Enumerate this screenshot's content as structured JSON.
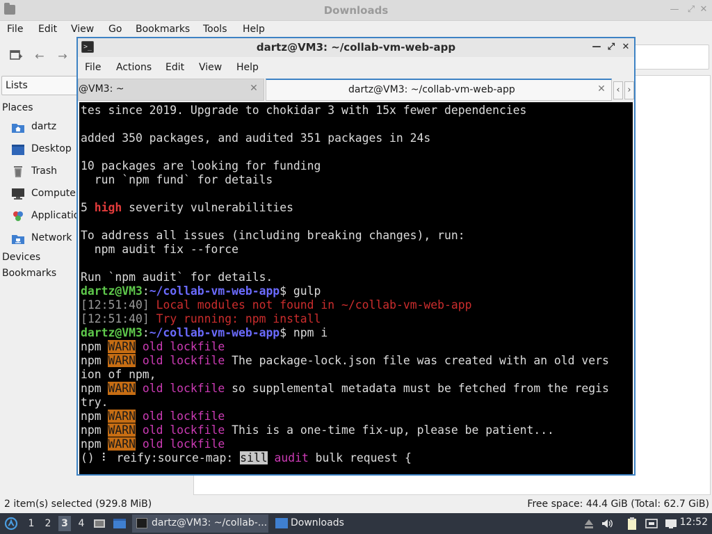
{
  "file_manager": {
    "title": "Downloads",
    "menu": [
      "File",
      "Edit",
      "View",
      "Go",
      "Bookmarks",
      "Tools",
      "Help"
    ],
    "side_combo": "Lists",
    "places_heading": "Places",
    "places": [
      {
        "label": "dartz",
        "icon": "home-folder-icon"
      },
      {
        "label": "Desktop",
        "icon": "desktop-icon"
      },
      {
        "label": "Trash",
        "icon": "trash-icon"
      },
      {
        "label": "Computer",
        "icon": "computer-icon"
      },
      {
        "label": "Applications",
        "icon": "applications-icon"
      },
      {
        "label": "Network",
        "icon": "network-icon"
      }
    ],
    "devices_heading": "Devices",
    "bookmarks_heading": "Bookmarks",
    "status_left": "2 item(s) selected (929.8 MiB)",
    "status_right": "Free space: 44.4 GiB (Total: 62.7 GiB)"
  },
  "terminal": {
    "title": "dartz@VM3: ~/collab-vm-web-app",
    "menu": [
      "File",
      "Actions",
      "Edit",
      "View",
      "Help"
    ],
    "tabs": [
      {
        "label": "@VM3: ~",
        "active": false
      },
      {
        "label": "dartz@VM3: ~/collab-vm-web-app",
        "active": true
      }
    ],
    "lines": [
      [
        {
          "t": "tes since 2019. Upgrade to chokidar 3 with 15x fewer dependencies"
        }
      ],
      [],
      [
        {
          "t": "added 350 packages, and audited 351 packages in 24s"
        }
      ],
      [],
      [
        {
          "t": "10 packages are looking for funding"
        }
      ],
      [
        {
          "t": "  run `npm fund` for details"
        }
      ],
      [],
      [
        {
          "t": "5 "
        },
        {
          "t": "high",
          "c": "red"
        },
        {
          "t": " severity vulnerabilities"
        }
      ],
      [],
      [
        {
          "t": "To address all issues (including breaking changes), run:"
        }
      ],
      [
        {
          "t": "  npm audit fix --force"
        }
      ],
      [],
      [
        {
          "t": "Run `npm audit` for details."
        }
      ],
      [
        {
          "t": "dartz@VM3",
          "c": "green"
        },
        {
          "t": ":"
        },
        {
          "t": "~/collab-vm-web-app",
          "c": "blue"
        },
        {
          "t": "$ gulp"
        }
      ],
      [
        {
          "t": "[",
          "c": "gray"
        },
        {
          "t": "12:51:40",
          "c": "gray"
        },
        {
          "t": "] ",
          "c": "gray"
        },
        {
          "t": "Local modules not found in ~/collab-vm-web-app",
          "c": "dred"
        }
      ],
      [
        {
          "t": "[",
          "c": "gray"
        },
        {
          "t": "12:51:40",
          "c": "gray"
        },
        {
          "t": "] ",
          "c": "gray"
        },
        {
          "t": "Try running: npm install",
          "c": "dred"
        }
      ],
      [
        {
          "t": "dartz@VM3",
          "c": "green"
        },
        {
          "t": ":"
        },
        {
          "t": "~/collab-vm-web-app",
          "c": "blue"
        },
        {
          "t": "$ npm i"
        }
      ],
      [
        {
          "t": "npm "
        },
        {
          "t": "WARN",
          "c": "warn"
        },
        {
          "t": " "
        },
        {
          "t": "old lockfile",
          "c": "mag"
        }
      ],
      [
        {
          "t": "npm "
        },
        {
          "t": "WARN",
          "c": "warn"
        },
        {
          "t": " "
        },
        {
          "t": "old lockfile",
          "c": "mag"
        },
        {
          "t": " The package-lock.json file was created with an old vers"
        }
      ],
      [
        {
          "t": "ion of npm,"
        }
      ],
      [
        {
          "t": "npm "
        },
        {
          "t": "WARN",
          "c": "warn"
        },
        {
          "t": " "
        },
        {
          "t": "old lockfile",
          "c": "mag"
        },
        {
          "t": " so supplemental metadata must be fetched from the regis"
        }
      ],
      [
        {
          "t": "try."
        }
      ],
      [
        {
          "t": "npm "
        },
        {
          "t": "WARN",
          "c": "warn"
        },
        {
          "t": " "
        },
        {
          "t": "old lockfile",
          "c": "mag"
        }
      ],
      [
        {
          "t": "npm "
        },
        {
          "t": "WARN",
          "c": "warn"
        },
        {
          "t": " "
        },
        {
          "t": "old lockfile",
          "c": "mag"
        },
        {
          "t": " This is a one-time fix-up, please be patient..."
        }
      ],
      [
        {
          "t": "npm "
        },
        {
          "t": "WARN",
          "c": "warn"
        },
        {
          "t": " "
        },
        {
          "t": "old lockfile",
          "c": "mag"
        }
      ],
      [
        {
          "t": "("
        },
        {
          "t": "",
          "c": "redact"
        },
        {
          "t": ") ⠇ reify:source-map: "
        },
        {
          "t": "sill",
          "c": "sill"
        },
        {
          "t": " "
        },
        {
          "t": "audit",
          "c": "mag"
        },
        {
          "t": " bulk request {"
        }
      ]
    ]
  },
  "taskbar": {
    "workspaces": [
      "1",
      "2",
      "3",
      "4"
    ],
    "active_workspace": "3",
    "tasks": [
      {
        "label": "dartz@VM3: ~/collab-...",
        "icon": "terminal-icon"
      },
      {
        "label": "Downloads",
        "icon": "folder-icon"
      }
    ],
    "clock": "12:52"
  },
  "colors": {
    "accent": "#3d82c4",
    "taskbar": "#2f3540",
    "terminal_bg": "#000000",
    "warn_bg": "#c66d13"
  }
}
